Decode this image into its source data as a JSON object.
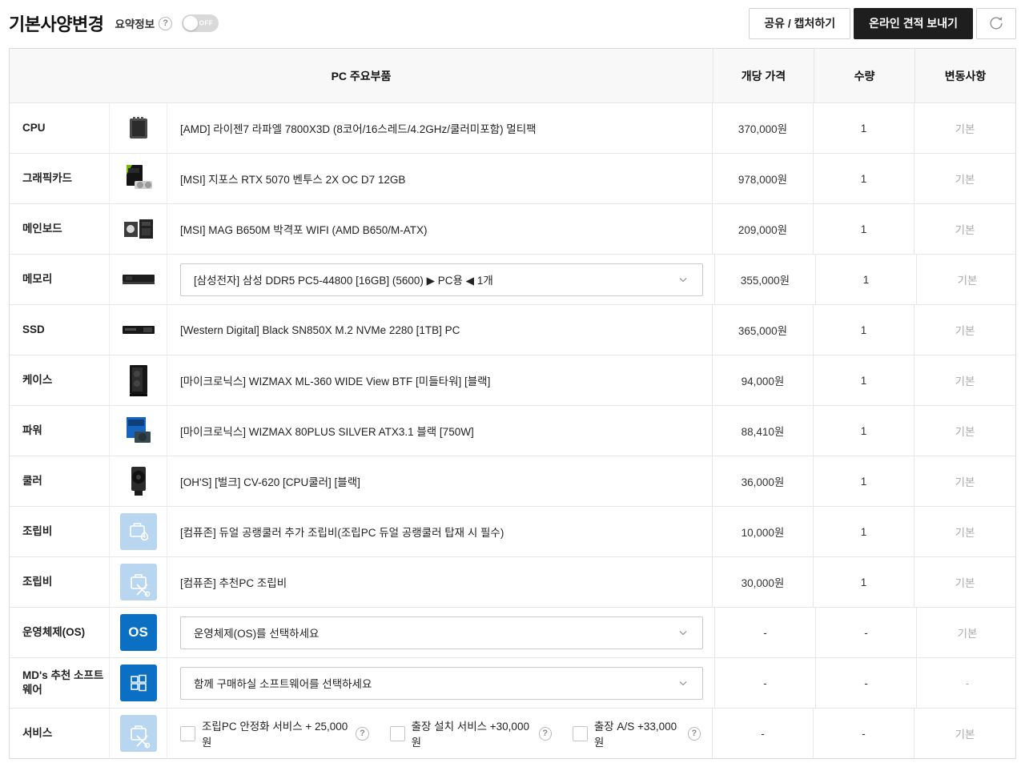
{
  "header": {
    "title": "기본사양변경",
    "summary_label": "요약정보",
    "toggle_state": "OFF",
    "share_button": "공유 / 캡처하기",
    "send_quote_button": "온라인 견적 보내기"
  },
  "table": {
    "columns": {
      "parts": "PC 주요부품",
      "unit_price": "개당 가격",
      "quantity": "수량",
      "changes": "변동사항"
    },
    "rows": [
      {
        "category": "CPU",
        "icon": "cpu-product-image",
        "name": "[AMD] 라이젠7 라파엘 7800X3D (8코어/16스레드/4.2GHz/쿨러미포함) 멀티팩",
        "price": "370,000원",
        "qty": "1",
        "change": "기본"
      },
      {
        "category": "그래픽카드",
        "icon": "gpu-product-image",
        "name": "[MSI] 지포스 RTX 5070 벤투스 2X OC D7 12GB",
        "price": "978,000원",
        "qty": "1",
        "change": "기본"
      },
      {
        "category": "메인보드",
        "icon": "mainboard-product-image",
        "name": "[MSI] MAG B650M 박격포 WIFI (AMD B650/M-ATX)",
        "price": "209,000원",
        "qty": "1",
        "change": "기본"
      },
      {
        "category": "메모리",
        "icon": "memory-product-image",
        "select_value": "[삼성전자] 삼성 DDR5 PC5-44800 [16GB] (5600) ▶ PC용 ◀ 1개",
        "price": "355,000원",
        "qty": "1",
        "change": "기본"
      },
      {
        "category": "SSD",
        "icon": "ssd-product-image",
        "name": "[Western Digital] Black SN850X M.2 NVMe 2280 [1TB] PC",
        "price": "365,000원",
        "qty": "1",
        "change": "기본"
      },
      {
        "category": "케이스",
        "icon": "case-product-image",
        "name": "[마이크로닉스] WIZMAX ML-360 WIDE View BTF [미들타워] [블랙]",
        "price": "94,000원",
        "qty": "1",
        "change": "기본"
      },
      {
        "category": "파워",
        "icon": "power-product-image",
        "name": "[마이크로닉스] WIZMAX 80PLUS SILVER ATX3.1 블랙 [750W]",
        "price": "88,410원",
        "qty": "1",
        "change": "기본"
      },
      {
        "category": "쿨러",
        "icon": "cooler-product-image",
        "name": "[OH'S] [벌크] CV-620 [CPU쿨러] [블랙]",
        "price": "36,000원",
        "qty": "1",
        "change": "기본"
      },
      {
        "category": "조립비",
        "icon": "assembly-cooler-icon",
        "name": "[컴퓨존] 듀얼 공랭쿨러 추가 조립비(조립PC 듀얼 공랭쿨러 탑재 시 필수)",
        "price": "10,000원",
        "qty": "1",
        "change": "기본"
      },
      {
        "category": "조립비",
        "icon": "assembly-tools-icon",
        "name": "[컴퓨존] 추천PC 조립비",
        "price": "30,000원",
        "qty": "1",
        "change": "기본"
      },
      {
        "category": "운영체제(OS)",
        "icon": "os-icon",
        "select_value": "운영체제(OS)를 선택하세요",
        "price": "-",
        "qty": "-",
        "change": "기본"
      },
      {
        "category": "MD's 추천 소프트웨어",
        "icon": "software-grid-icon",
        "select_value": "함께 구매하실 소프트웨어를 선택하세요",
        "price": "-",
        "qty": "-",
        "change": "-"
      },
      {
        "category": "서비스",
        "icon": "service-tools-icon",
        "options": [
          "조립PC 안정화 서비스 + 25,000원",
          "출장 설치 서비스 +30,000원",
          "출장 A/S +33,000원"
        ],
        "price": "-",
        "qty": "-",
        "change": "기본"
      }
    ]
  },
  "colors": {
    "accent_blue": "#0b6fc3",
    "light_blue": "#b9d6f1",
    "dark_button": "#1e1e1e"
  }
}
